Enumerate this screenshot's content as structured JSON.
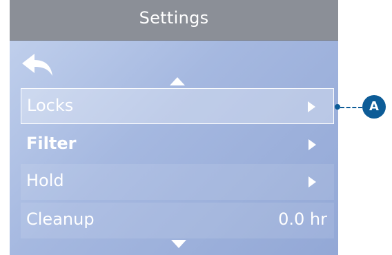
{
  "header": {
    "title": "Settings"
  },
  "nav": {
    "back_icon": "back-arrow-icon",
    "scroll_up_icon": "triangle-up-icon",
    "scroll_down_icon": "triangle-down-icon"
  },
  "menu": {
    "items": [
      {
        "label": "Locks",
        "type": "submenu",
        "selected": true
      },
      {
        "label": "Filter",
        "type": "submenu",
        "selected": false
      },
      {
        "label": "Hold",
        "type": "submenu",
        "selected": false
      },
      {
        "label": "Cleanup",
        "type": "value",
        "value": "0.0 hr",
        "selected": false
      }
    ]
  },
  "callout": {
    "label": "A",
    "color": "#0d5c97"
  },
  "colors": {
    "titlebar": "#8b8f97",
    "screen_gradient_start": "#c4d3ee",
    "screen_gradient_end": "#93a8d6",
    "text": "#ffffff"
  }
}
